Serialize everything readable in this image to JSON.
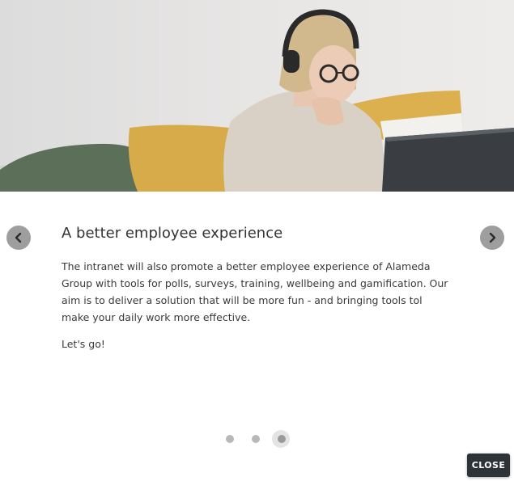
{
  "slide": {
    "title": "A better employee experience",
    "body": "The intranet will also promote a better employee experience of Alameda Group with tools for polls, surveys, training, wellbeing and gamification. Our aim is to deliver a solution that will be more fun - and bringing tools tol make your daily work more effective.",
    "cta": "Let's go!"
  },
  "carousel": {
    "total_slides": 3,
    "active_slide": 3,
    "prev_icon": "chevron-left-icon",
    "next_icon": "chevron-right-icon"
  },
  "close_button": {
    "label": "CLOSE"
  },
  "colors": {
    "close_button_bg": "#2e3338",
    "nav_button_bg": "#9e9e9e",
    "dot_inactive": "#b8b8b8",
    "dot_active": "#9a9a9a"
  }
}
